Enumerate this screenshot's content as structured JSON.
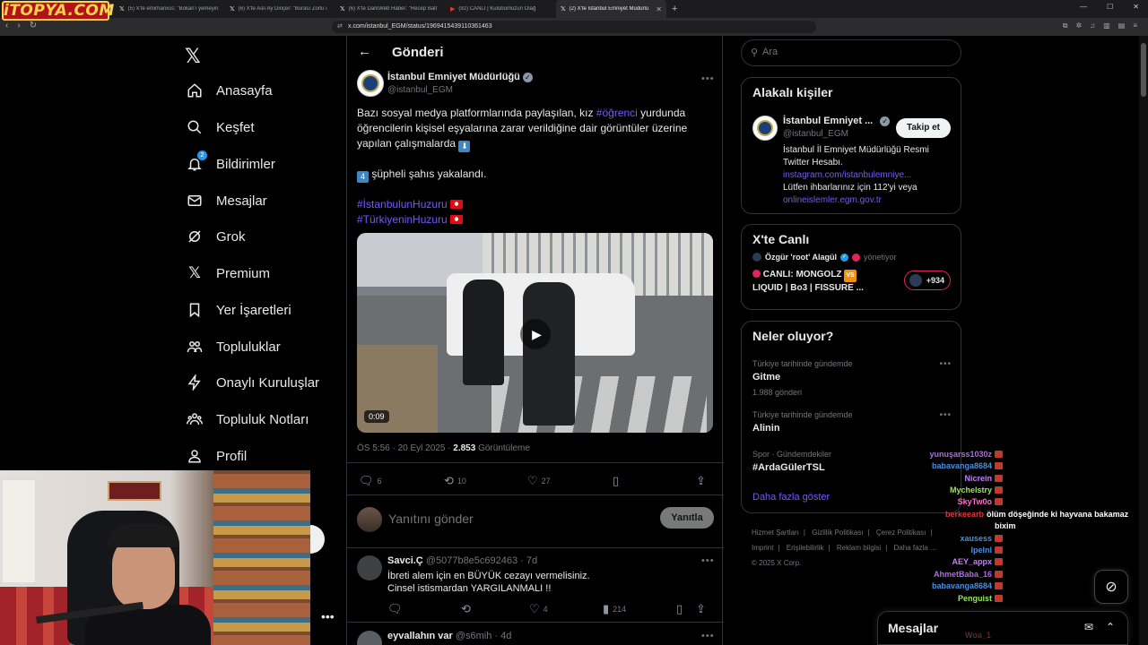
{
  "overlay_logo": "iTOPYA.COM",
  "browser": {
    "tabs": [
      {
        "label": "(5) X'te emirhanxss: \"Bokan'ı yemeyin",
        "active": false
      },
      {
        "label": "(6) X'te Aslı Ay Dinçer: \"Burası Zorlu ı",
        "active": false
      },
      {
        "label": "(6) X'te DarkWeb Haber: \"Recep Balt",
        "active": false
      },
      {
        "label": "(92) CANLI | Kulübümüzün Olağ",
        "active": false
      },
      {
        "label": "(2) X'te İstanbul Emniyet Müdürlü",
        "active": true
      }
    ],
    "url": "x.com/istanbul_EGM/status/1969415439110361463"
  },
  "nav": {
    "items": [
      {
        "label": "Anasayfa",
        "icon": "home-icon"
      },
      {
        "label": "Keşfet",
        "icon": "search-icon"
      },
      {
        "label": "Bildirimler",
        "icon": "bell-icon",
        "badge": "2"
      },
      {
        "label": "Mesajlar",
        "icon": "mail-icon"
      },
      {
        "label": "Grok",
        "icon": "grok-icon"
      },
      {
        "label": "Premium",
        "icon": "x-icon"
      },
      {
        "label": "Yer İşaretleri",
        "icon": "bookmark-icon"
      },
      {
        "label": "Topluluklar",
        "icon": "people-icon"
      },
      {
        "label": "Onaylı Kuruluşlar",
        "icon": "lightning-icon"
      },
      {
        "label": "Topluluk Notları",
        "icon": "community-notes-icon"
      },
      {
        "label": "Profil",
        "icon": "user-icon"
      }
    ]
  },
  "header": {
    "title": "Gönderi"
  },
  "post": {
    "author_name": "İstanbul Emniyet Müdürlüğü",
    "author_handle": "@istanbul_EGM",
    "text_line1_a": "Bazı sosyal medya platformlarında paylaşılan, kız ",
    "text_hashtag1": "#öğrenci",
    "text_line1_b": " yurdunda öğrencilerin kişisel eşyalarına zarar verildiğine dair görüntüler üzerine yapılan çalışmalarda ",
    "emoji_down": "⬇",
    "emoji_four": "4",
    "text_line2": " şüpheli şahıs yakalandı.",
    "hashtag2": "#İstanbulunHuzuru",
    "hashtag3": "#TürkiyeninHuzuru",
    "video_duration": "0:09",
    "time": "ÖS 5:56 · 20 Eyl 2025 · ",
    "views": "2.853",
    "views_label": " Görüntüleme",
    "replies": "6",
    "reposts": "10",
    "likes": "27"
  },
  "reply_box": {
    "placeholder": "Yanıtını gönder",
    "button": "Yanıtla"
  },
  "replies": [
    {
      "name": "Savci.Ç",
      "handle": "@5077b8e5c692463 · 7d",
      "line1": "İbreti alem için en BÜYÜK cezayı vermelisiniz.",
      "line2": "Cinsel istismardan YARGILANMALI !!",
      "replies": "",
      "reposts": "",
      "likes": "4",
      "views": "214"
    },
    {
      "name": "eyvallahın var",
      "handle": "@s6mih · 4d"
    }
  ],
  "right": {
    "search_placeholder": "Ara",
    "related_title": "Alakalı kişiler",
    "related_name": "İstanbul Emniyet ...",
    "related_handle": "@istanbul_EGM",
    "follow_label": "Takip et",
    "related_bio": "İstanbul İl Emniyet Müdürlüğü Resmi Twitter Hesabı.",
    "related_link1": "instagram.com/istanbulemniye...",
    "related_bio2": "Lütfen ihbarlarınız için 112'yi veya",
    "related_link2": "onlineislemler.egm.gov.tr",
    "live_title": "X'te Canlı",
    "live_host": "Özgür 'root' Alagül",
    "live_role": "yönetiyor",
    "live_stream_a": "CANLI: MONGOLZ ",
    "live_vs": "VS",
    "live_stream_b": "LIQUID | Bo3 | FISSURE ...",
    "live_count": "+934",
    "trends_title": "Neler oluyor?",
    "trends": [
      {
        "context": "Türkiye tarihinde gündemde",
        "name": "Gitme",
        "count": "1.988 gönderi"
      },
      {
        "context": "Türkiye tarihinde gündemde",
        "name": "Alinin",
        "count": ""
      },
      {
        "context": "Spor · Gündemdekiler",
        "name": "#ArdaGülerTSL",
        "count": ""
      }
    ],
    "show_more": "Daha fazla göster",
    "footer": [
      "Hizmet Şartları",
      "Gizlilik Politikası",
      "Çerez Politikası",
      "Imprint",
      "Erişilebilirlik",
      "Reklam bilgisi",
      "Daha fazla ...",
      "© 2025 X Corp."
    ]
  },
  "chat": [
    {
      "user": "yunuşarss1030z",
      "color": "#b06adf",
      "msg": ""
    },
    {
      "user": "babavanga8684",
      "color": "#4a90e2",
      "msg": ""
    },
    {
      "user": "Nicrein",
      "color": "#c77dff",
      "msg": ""
    },
    {
      "user": "Mychelstry",
      "color": "#9ae65e",
      "msg": ""
    },
    {
      "user": "SkyTw0o",
      "color": "#ff6ec7",
      "msg": ""
    },
    {
      "user": "berkeearb",
      "color": "#e03535",
      "msg": "ölüm döşeğinde ki hayvana bakamaz"
    },
    {
      "user": "",
      "color": "#ffffff",
      "msg": "bixim"
    },
    {
      "user": "xausess",
      "color": "#4a90e2",
      "msg": ""
    },
    {
      "user": "Ipelnl",
      "color": "#4a90e2",
      "msg": ""
    },
    {
      "user": "AEY_appx",
      "color": "#c77dff",
      "msg": ""
    },
    {
      "user": "AhmetBaba_16",
      "color": "#b06adf",
      "msg": ""
    },
    {
      "user": "babavanga8684",
      "color": "#4a90e2",
      "msg": ""
    },
    {
      "user": "Penguist",
      "color": "#9ae65e",
      "msg": ""
    }
  ],
  "chat_tail": "Woa_1",
  "messages_drawer": {
    "title": "Mesajlar"
  }
}
